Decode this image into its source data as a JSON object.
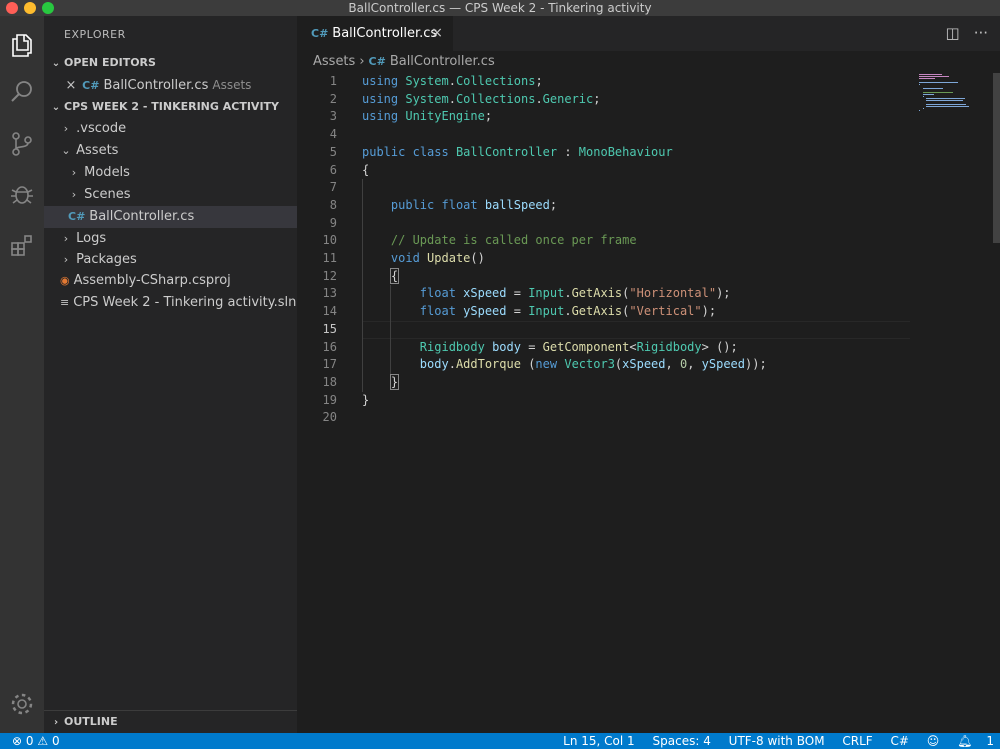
{
  "window": {
    "title": "BallController.cs — CPS Week 2 - Tinkering activity"
  },
  "activity_bar": {
    "icons": [
      "files-icon",
      "search-icon",
      "source-control-icon",
      "debug-icon",
      "extensions-icon",
      "settings-gear-icon"
    ]
  },
  "sidebar": {
    "title": "EXPLORER",
    "open_editors": {
      "label": "OPEN EDITORS",
      "items": [
        {
          "name": "BallController.cs",
          "folder": "Assets"
        }
      ]
    },
    "workspace": {
      "label": "CPS WEEK 2 - TINKERING ACTIVITY",
      "tree": [
        {
          "label": ".vscode",
          "type": "folder",
          "expanded": false
        },
        {
          "label": "Assets",
          "type": "folder",
          "expanded": true
        },
        {
          "label": "Models",
          "type": "folder",
          "expanded": false
        },
        {
          "label": "Scenes",
          "type": "folder",
          "expanded": false
        },
        {
          "label": "BallController.cs",
          "type": "csharp-file",
          "selected": true
        },
        {
          "label": "Logs",
          "type": "folder",
          "expanded": false
        },
        {
          "label": "Packages",
          "type": "folder",
          "expanded": false
        },
        {
          "label": "Assembly-CSharp.csproj",
          "type": "project-file"
        },
        {
          "label": "CPS Week 2 - Tinkering activity.sln",
          "type": "solution-file"
        }
      ]
    },
    "outline_label": "OUTLINE"
  },
  "editor": {
    "tab": {
      "label": "BallController.cs",
      "icon": "csharp-icon"
    },
    "breadcrumb": [
      "Assets",
      "BallController.cs"
    ],
    "line_numbers": [
      "1",
      "2",
      "3",
      "4",
      "5",
      "6",
      "7",
      "8",
      "9",
      "10",
      "11",
      "12",
      "13",
      "14",
      "15",
      "16",
      "17",
      "18",
      "19",
      "20"
    ],
    "active_line": 15,
    "code_lines": [
      "using System.Collections;",
      "using System.Collections.Generic;",
      "using UnityEngine;",
      "",
      "public class BallController : MonoBehaviour",
      "{",
      "",
      "    public float ballSpeed;",
      "",
      "    // Update is called once per frame",
      "    void Update()",
      "    {",
      "        float xSpeed = Input.GetAxis(\"Horizontal\");",
      "        float ySpeed = Input.GetAxis(\"Vertical\");",
      "",
      "        Rigidbody body = GetComponent<Rigidbody> ();",
      "        body.AddTorque (new Vector3(xSpeed, 0, ySpeed));",
      "    }",
      "}",
      ""
    ]
  },
  "statusbar": {
    "errors": "0",
    "warnings": "0",
    "position": "Ln 15, Col 1",
    "spaces": "Spaces: 4",
    "encoding": "UTF-8 with BOM",
    "eol": "CRLF",
    "language": "C#",
    "notifications": "1"
  },
  "colors": {
    "accent": "#007acc",
    "editor_bg": "#1e1e1e",
    "sidebar_bg": "#252526",
    "activity_bg": "#333333",
    "keyword": "#569cd6",
    "type": "#4ec9b0",
    "function": "#dcdcaa",
    "string": "#ce9178",
    "comment": "#6a9955"
  }
}
